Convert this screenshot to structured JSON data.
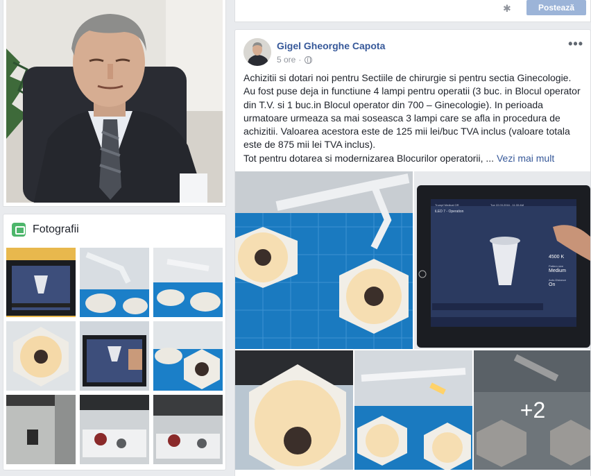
{
  "composer": {
    "post_label": "Postează",
    "gear_icon": "gear-icon"
  },
  "photos_widget": {
    "title": "Fotografii",
    "icon": "photos-icon",
    "tile_count": 9
  },
  "post": {
    "author": "Gigel Gheorghe Capota",
    "time": "5 ore",
    "separator": "·",
    "privacy_icon": "globe-icon",
    "more_label": "•••",
    "text_lines": [
      "Achizitii si dotari noi pentru Sectiile de chirurgie si pentru sectia Ginecologie.",
      "Au fost puse deja in functiune 4 lampi pentru operatii (3 buc. in Blocul operator",
      "din T.V. si 1 buc.in Blocul operator din 700 – Ginecologie). In perioada",
      "urmatoare urmeaza sa mai soseasca 3 lampi care se afla in procedura de",
      "achizitii. Valoarea acestora este de 125 mii lei/buc TVA inclus (valoare totala",
      "este de 875 mii lei TVA inclus)."
    ],
    "last_line": "Tot pentru dotarea si modernizarea Blocurilor operatorii, ... ",
    "see_more": "Vezi mai mult",
    "more_photos": "+2"
  },
  "tablet_screen": {
    "brand": "Trumpf Medical OR",
    "date": "Tue 22.03.2016 - 11:33 AM",
    "light_name": "iLED 7 - Operation",
    "temp": "4500 K",
    "pattern_label": "Pattern size",
    "pattern_value": "Medium",
    "auto_label": "Auto-Distance",
    "auto_value": "On"
  },
  "colors": {
    "link": "#365899",
    "accent": "#4267b2",
    "button_disabled": "#9cb4d8",
    "tile_blue": "#1b7fc8"
  }
}
